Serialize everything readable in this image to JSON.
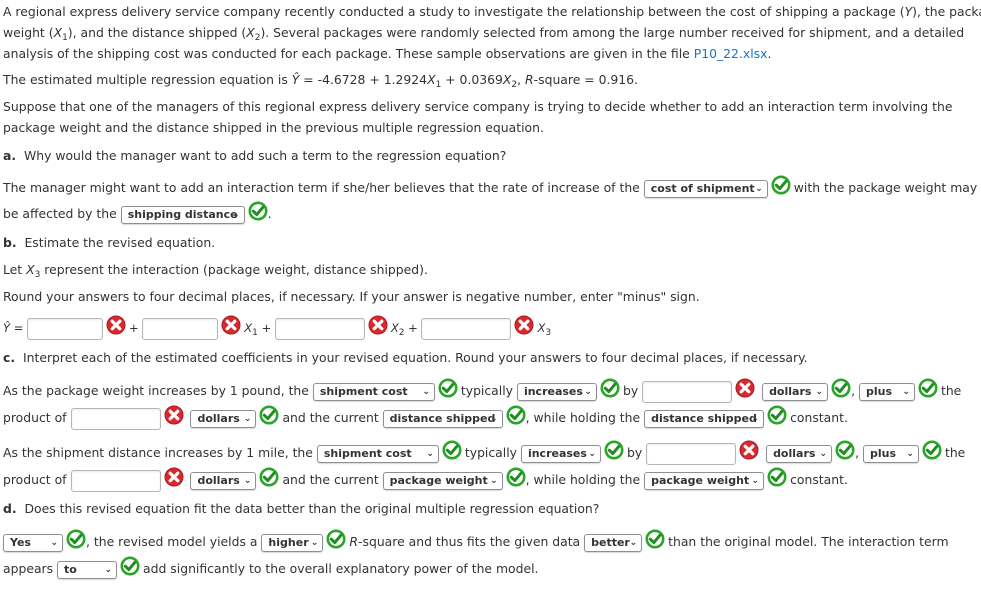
{
  "intro": {
    "line1": "A regional express delivery service company recently conducted a study to investigate the relationship between the cost of shipping a package (",
    "y_var": "Y",
    "line1b": "), the package",
    "line2a": "weight (",
    "x1": "X",
    "x1_sub": "1",
    "line2b": "), and the distance shipped (",
    "x2_sub": "2",
    "line2c": "). Several packages were randomly selected from among the large number received for shipment, and a detailed",
    "line3a": "analysis of the shipping cost was conducted for each package. These sample observations are given in the file ",
    "file_link": "P10_22.xlsx",
    "line3b": "."
  },
  "equation_text": {
    "prefix": "The estimated multiple regression equation is ",
    "yhat": "Ŷ",
    "body1": " = -4.6728 + 1.2924",
    "body2": " + 0.0369",
    "body3": ", ",
    "r": "R",
    "rsq": "-square = 0.916."
  },
  "suppose": {
    "line1": "Suppose that one of the managers of this regional express delivery service company is trying to decide whether to add an interaction term involving the",
    "line2": "package weight and the distance shipped in the previous multiple regression equation."
  },
  "part_a": {
    "label": "a.",
    "question": "Why would the manager want to add such a term to the regression equation?",
    "s1": "The manager might want to add an interaction term if she/her believes that the rate of increase of the",
    "sel1": "cost of shipment",
    "s2": "with the package weight may",
    "s3": "be affected by the",
    "sel2": "shipping distance",
    "s4": "."
  },
  "part_b": {
    "label": "b.",
    "question": "Estimate the revised equation.",
    "let_a": "Let ",
    "let_var": "X",
    "let_sub": "3",
    "let_b": " represent the interaction (package weight, distance shipped).",
    "round": "Round your answers to four decimal places, if necessary. If your answer is negative number, enter \"minus\" sign.",
    "yhat": "Ŷ",
    "eq": "=",
    "plus": "+",
    "xvar": "X",
    "subs": [
      "1",
      "2",
      "3"
    ],
    "inputs": [
      "",
      "",
      "",
      ""
    ]
  },
  "part_c": {
    "label": "c.",
    "question": "Interpret each of the estimated coefficients in your revised equation. Round your answers to four decimal places, if necessary.",
    "row1": {
      "s1": "As the package weight increases by 1 pound, the",
      "sel1": "shipment cost",
      "s2": "typically",
      "sel2": "increases",
      "s3": "by",
      "input1": "",
      "sel3": "dollars",
      "comma": ",",
      "sel4": "plus",
      "s4": "the",
      "s5": "product of",
      "input2": "",
      "sel5": "dollars",
      "s6": "and the current",
      "sel6": "distance shipped",
      "s7": ", while holding the",
      "sel7": "distance shipped",
      "s8": "constant."
    },
    "row2": {
      "s1": "As the shipment distance increases by 1 mile, the",
      "sel1": "shipment cost",
      "s2": "typically",
      "sel2": "increases",
      "s3": "by",
      "input1": "",
      "sel3": "dollars",
      "comma": ",",
      "sel4": "plus",
      "s4": "the",
      "s5": "product of",
      "input2": "",
      "sel5": "dollars",
      "s6": "and the current",
      "sel6": "package weight",
      "s7": ", while holding the",
      "sel7": "package weight",
      "s8": "constant."
    }
  },
  "part_d": {
    "label": "d.",
    "question": "Does this revised equation fit the data better than the original multiple regression equation?",
    "sel1": "Yes",
    "s1": ", the revised model yields a",
    "sel2": "higher",
    "r": "R",
    "s2": "-square and thus fits the given data",
    "sel3": "better",
    "s3": "than the original model. The interaction term",
    "s4": "appears",
    "sel4": "to",
    "s5": "add significantly to the overall explanatory power of the model."
  },
  "colors": {
    "link": "#1a73c7",
    "correct": "#2aa52a",
    "incorrect": "#d9282f"
  }
}
